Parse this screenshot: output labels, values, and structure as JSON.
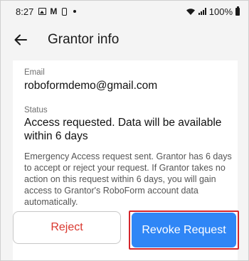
{
  "status_bar": {
    "time": "8:27",
    "icons": [
      "image-icon",
      "gmail-icon",
      "lock-icon",
      "dot-icon"
    ],
    "battery": "100%",
    "right_icons": [
      "wifi-icon",
      "signal-icon",
      "battery-icon"
    ]
  },
  "app_bar": {
    "back_icon": "arrow-left-icon",
    "title": "Grantor info"
  },
  "email": {
    "label": "Email",
    "value": "roboformdemo@gmail.com"
  },
  "status": {
    "label": "Status",
    "value": "Access requested. Data will be available within 6 days"
  },
  "notice": "Emergency Access request sent. Grantor has 6 days to accept or reject your request. If Grantor takes no action on this request within 6 days, you will gain access to Grantor's RoboForm account data automatically.",
  "actions": {
    "reject_label": "Reject",
    "revoke_label": "Revoke Request"
  },
  "colors": {
    "primary": "#2f86f6",
    "danger": "#d9372e",
    "highlight": "#d4262c"
  }
}
